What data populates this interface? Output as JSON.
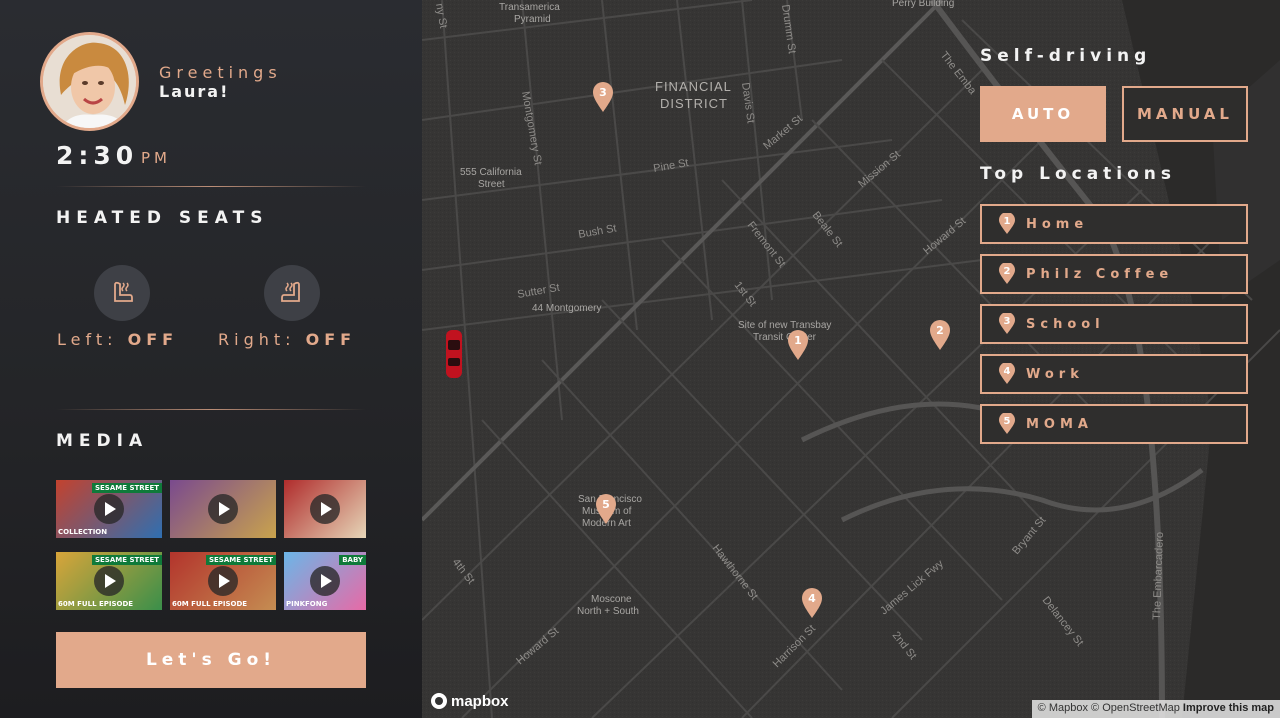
{
  "profile": {
    "greeting": "Greetings",
    "name": "Laura!",
    "time": "2:30",
    "ampm": "PM"
  },
  "heated_seats": {
    "title": "HEATED SEATS",
    "left_label": "Left:",
    "left_state": "OFF",
    "right_label": "Right:",
    "right_state": "OFF"
  },
  "media": {
    "title": "MEDIA",
    "thumbnails": [
      {
        "badge": "SESAME STREET",
        "tag": "COLLECTION",
        "colors": [
          "#c3422e",
          "#2f6fb1"
        ]
      },
      {
        "badge": "",
        "tag": "",
        "colors": [
          "#7a4a8e",
          "#c9a34d"
        ]
      },
      {
        "badge": "",
        "tag": "",
        "colors": [
          "#b02c2c",
          "#e6d6b8"
        ]
      },
      {
        "badge": "SESAME STREET",
        "tag": "60M FULL EPISODE",
        "colors": [
          "#d9a53a",
          "#3a8f4a"
        ]
      },
      {
        "badge": "SESAME STREET",
        "tag": "60M FULL EPISODE",
        "colors": [
          "#b3342c",
          "#c58d52"
        ]
      },
      {
        "badge": "BABY",
        "tag": "PINKFONG",
        "colors": [
          "#6bb6e8",
          "#e76aa6"
        ]
      }
    ],
    "go_label": "Let's Go!"
  },
  "self_driving": {
    "title": "Self-driving",
    "auto_label": "AUTO",
    "manual_label": "MANUAL",
    "active": "AUTO"
  },
  "top_locations": {
    "title": "Top Locations",
    "items": [
      {
        "num": "1",
        "label": "Home"
      },
      {
        "num": "2",
        "label": "Philz Coffee"
      },
      {
        "num": "3",
        "label": "School"
      },
      {
        "num": "4",
        "label": "Work"
      },
      {
        "num": "5",
        "label": "MOMA"
      }
    ]
  },
  "map": {
    "streets": [
      "Montgomery St",
      "Pine St",
      "Bush St",
      "Sutter St",
      "Market St",
      "Mission St",
      "Davis St",
      "Drumm St",
      "Fremont St",
      "Beale St",
      "Howard St",
      "1st St",
      "Hawthorne St",
      "Harrison St",
      "James Lick Fwy",
      "2nd St",
      "Bryant St",
      "Delancey St",
      "The Embarcadero",
      "4th St",
      "Howard St",
      "The Embarcadero",
      "Ny St"
    ],
    "places": [
      "Transamerica Pyramid",
      "FINANCIAL DISTRICT",
      "555 California Street",
      "44 Montgomery",
      "Site of new Transbay Transit Center",
      "San Francisco Museum of Modern Art",
      "Moscone North + South",
      "Perry Building"
    ],
    "pins": [
      "1",
      "2",
      "3",
      "4",
      "5"
    ],
    "logo": "mapbox",
    "attribution_1": "© Mapbox",
    "attribution_2": "© OpenStreetMap",
    "attribution_3": "Improve this map"
  },
  "colors": {
    "accent": "#e2a98b",
    "panel": "#242528",
    "map": "#363534"
  }
}
